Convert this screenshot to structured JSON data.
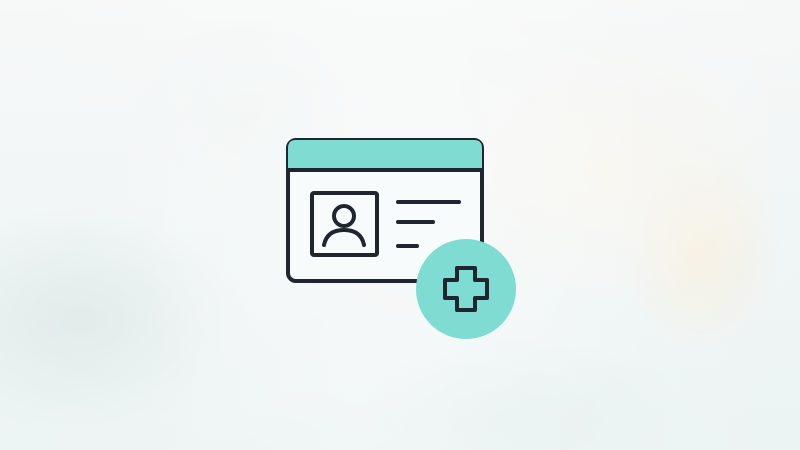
{
  "icons": {
    "main": "id-card-add-icon",
    "photo": "person-icon",
    "badge": "plus-icon"
  },
  "colors": {
    "accent": "#7fdcd3",
    "outline": "#1f2630",
    "card_fill": "#f7fbfb"
  }
}
